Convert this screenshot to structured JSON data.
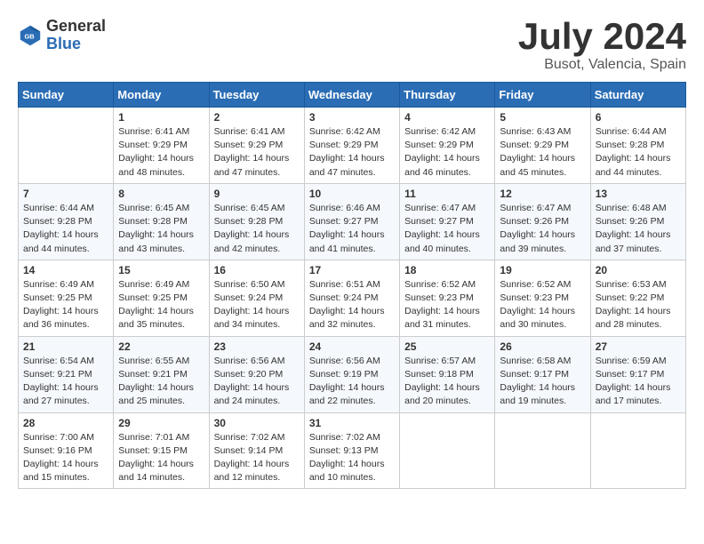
{
  "header": {
    "logo_line1": "General",
    "logo_line2": "Blue",
    "month_year": "July 2024",
    "location": "Busot, Valencia, Spain"
  },
  "weekdays": [
    "Sunday",
    "Monday",
    "Tuesday",
    "Wednesday",
    "Thursday",
    "Friday",
    "Saturday"
  ],
  "weeks": [
    [
      {
        "day": "",
        "info": ""
      },
      {
        "day": "1",
        "info": "Sunrise: 6:41 AM\nSunset: 9:29 PM\nDaylight: 14 hours\nand 48 minutes."
      },
      {
        "day": "2",
        "info": "Sunrise: 6:41 AM\nSunset: 9:29 PM\nDaylight: 14 hours\nand 47 minutes."
      },
      {
        "day": "3",
        "info": "Sunrise: 6:42 AM\nSunset: 9:29 PM\nDaylight: 14 hours\nand 47 minutes."
      },
      {
        "day": "4",
        "info": "Sunrise: 6:42 AM\nSunset: 9:29 PM\nDaylight: 14 hours\nand 46 minutes."
      },
      {
        "day": "5",
        "info": "Sunrise: 6:43 AM\nSunset: 9:29 PM\nDaylight: 14 hours\nand 45 minutes."
      },
      {
        "day": "6",
        "info": "Sunrise: 6:44 AM\nSunset: 9:28 PM\nDaylight: 14 hours\nand 44 minutes."
      }
    ],
    [
      {
        "day": "7",
        "info": "Sunrise: 6:44 AM\nSunset: 9:28 PM\nDaylight: 14 hours\nand 44 minutes."
      },
      {
        "day": "8",
        "info": "Sunrise: 6:45 AM\nSunset: 9:28 PM\nDaylight: 14 hours\nand 43 minutes."
      },
      {
        "day": "9",
        "info": "Sunrise: 6:45 AM\nSunset: 9:28 PM\nDaylight: 14 hours\nand 42 minutes."
      },
      {
        "day": "10",
        "info": "Sunrise: 6:46 AM\nSunset: 9:27 PM\nDaylight: 14 hours\nand 41 minutes."
      },
      {
        "day": "11",
        "info": "Sunrise: 6:47 AM\nSunset: 9:27 PM\nDaylight: 14 hours\nand 40 minutes."
      },
      {
        "day": "12",
        "info": "Sunrise: 6:47 AM\nSunset: 9:26 PM\nDaylight: 14 hours\nand 39 minutes."
      },
      {
        "day": "13",
        "info": "Sunrise: 6:48 AM\nSunset: 9:26 PM\nDaylight: 14 hours\nand 37 minutes."
      }
    ],
    [
      {
        "day": "14",
        "info": "Sunrise: 6:49 AM\nSunset: 9:25 PM\nDaylight: 14 hours\nand 36 minutes."
      },
      {
        "day": "15",
        "info": "Sunrise: 6:49 AM\nSunset: 9:25 PM\nDaylight: 14 hours\nand 35 minutes."
      },
      {
        "day": "16",
        "info": "Sunrise: 6:50 AM\nSunset: 9:24 PM\nDaylight: 14 hours\nand 34 minutes."
      },
      {
        "day": "17",
        "info": "Sunrise: 6:51 AM\nSunset: 9:24 PM\nDaylight: 14 hours\nand 32 minutes."
      },
      {
        "day": "18",
        "info": "Sunrise: 6:52 AM\nSunset: 9:23 PM\nDaylight: 14 hours\nand 31 minutes."
      },
      {
        "day": "19",
        "info": "Sunrise: 6:52 AM\nSunset: 9:23 PM\nDaylight: 14 hours\nand 30 minutes."
      },
      {
        "day": "20",
        "info": "Sunrise: 6:53 AM\nSunset: 9:22 PM\nDaylight: 14 hours\nand 28 minutes."
      }
    ],
    [
      {
        "day": "21",
        "info": "Sunrise: 6:54 AM\nSunset: 9:21 PM\nDaylight: 14 hours\nand 27 minutes."
      },
      {
        "day": "22",
        "info": "Sunrise: 6:55 AM\nSunset: 9:21 PM\nDaylight: 14 hours\nand 25 minutes."
      },
      {
        "day": "23",
        "info": "Sunrise: 6:56 AM\nSunset: 9:20 PM\nDaylight: 14 hours\nand 24 minutes."
      },
      {
        "day": "24",
        "info": "Sunrise: 6:56 AM\nSunset: 9:19 PM\nDaylight: 14 hours\nand 22 minutes."
      },
      {
        "day": "25",
        "info": "Sunrise: 6:57 AM\nSunset: 9:18 PM\nDaylight: 14 hours\nand 20 minutes."
      },
      {
        "day": "26",
        "info": "Sunrise: 6:58 AM\nSunset: 9:17 PM\nDaylight: 14 hours\nand 19 minutes."
      },
      {
        "day": "27",
        "info": "Sunrise: 6:59 AM\nSunset: 9:17 PM\nDaylight: 14 hours\nand 17 minutes."
      }
    ],
    [
      {
        "day": "28",
        "info": "Sunrise: 7:00 AM\nSunset: 9:16 PM\nDaylight: 14 hours\nand 15 minutes."
      },
      {
        "day": "29",
        "info": "Sunrise: 7:01 AM\nSunset: 9:15 PM\nDaylight: 14 hours\nand 14 minutes."
      },
      {
        "day": "30",
        "info": "Sunrise: 7:02 AM\nSunset: 9:14 PM\nDaylight: 14 hours\nand 12 minutes."
      },
      {
        "day": "31",
        "info": "Sunrise: 7:02 AM\nSunset: 9:13 PM\nDaylight: 14 hours\nand 10 minutes."
      },
      {
        "day": "",
        "info": ""
      },
      {
        "day": "",
        "info": ""
      },
      {
        "day": "",
        "info": ""
      }
    ]
  ]
}
